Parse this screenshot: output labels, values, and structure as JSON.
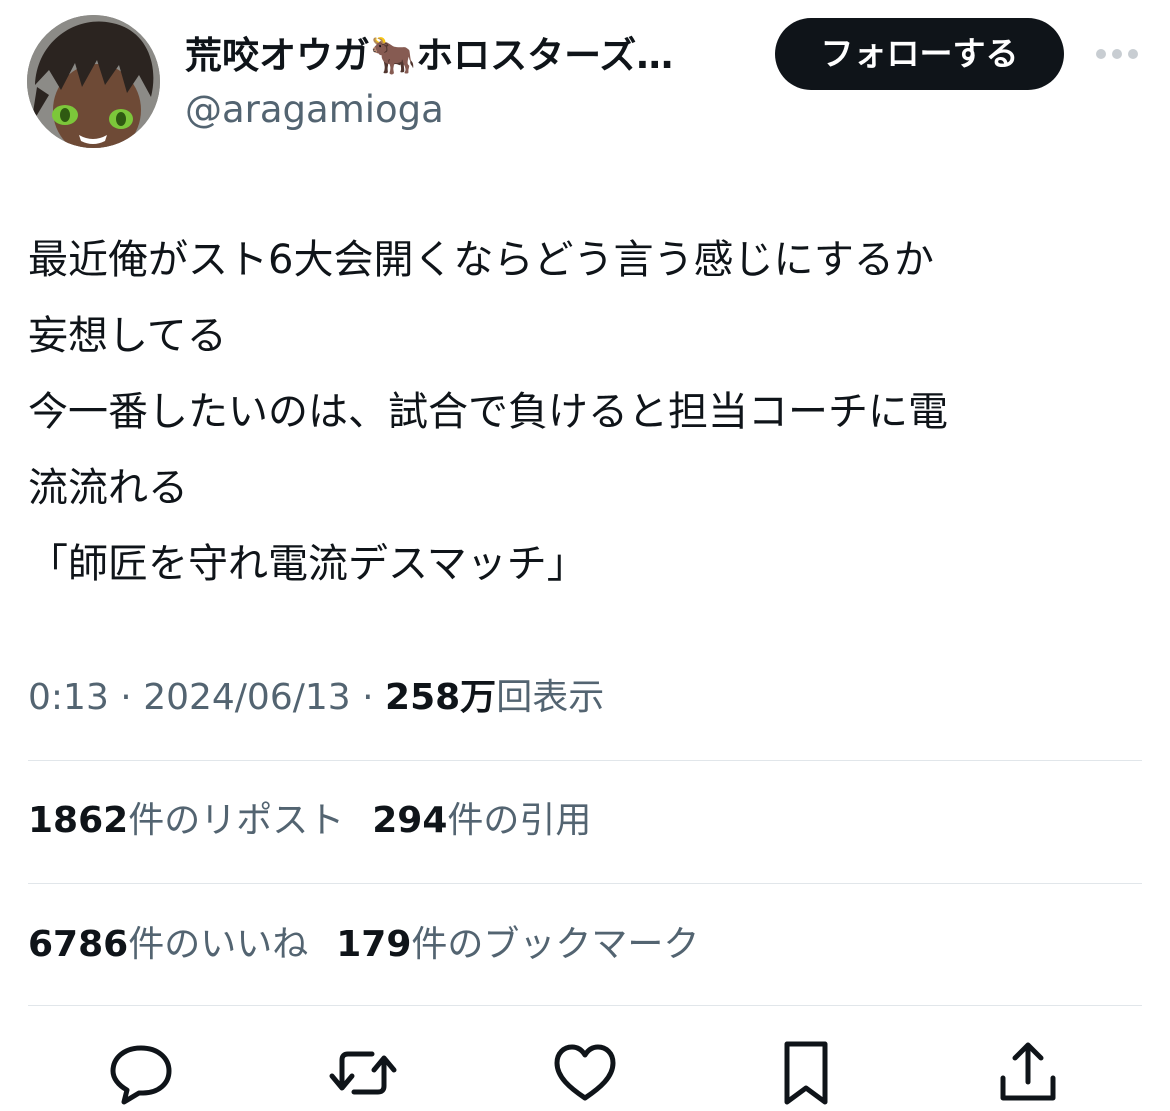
{
  "author": {
    "display_name": "荒咬オウガ🐂ホロスターズ…",
    "handle": "@aragamioga"
  },
  "follow_button": {
    "label": "フォローする"
  },
  "tweet": {
    "text": "最近俺がスト6大会開くならどう言う感じにするか\n妄想してる\n今一番したいのは、試合で負けると担当コーチに電\n流流れる\n「師匠を守れ電流デスマッチ」"
  },
  "meta": {
    "time": "0:13",
    "separator": " · ",
    "date": "2024/06/13",
    "views_count": "258万",
    "views_label": "回表示"
  },
  "stats": {
    "reposts": {
      "count": "1862",
      "label": "件のリポスト"
    },
    "quotes": {
      "count": "294",
      "label": "件の引用"
    },
    "likes": {
      "count": "6786",
      "label": "件のいいね"
    },
    "bookmarks": {
      "count": "179",
      "label": "件のブックマーク"
    }
  },
  "icons": {
    "more": "more-horizontal-icon",
    "reply": "reply-icon",
    "repost": "repost-icon",
    "like": "heart-icon",
    "bookmark": "bookmark-icon",
    "share": "share-icon"
  },
  "colors": {
    "text_primary": "#0f1419",
    "text_secondary": "#536471",
    "divider": "#e1e6ea",
    "button_bg": "#0f1419",
    "button_text": "#ffffff"
  }
}
